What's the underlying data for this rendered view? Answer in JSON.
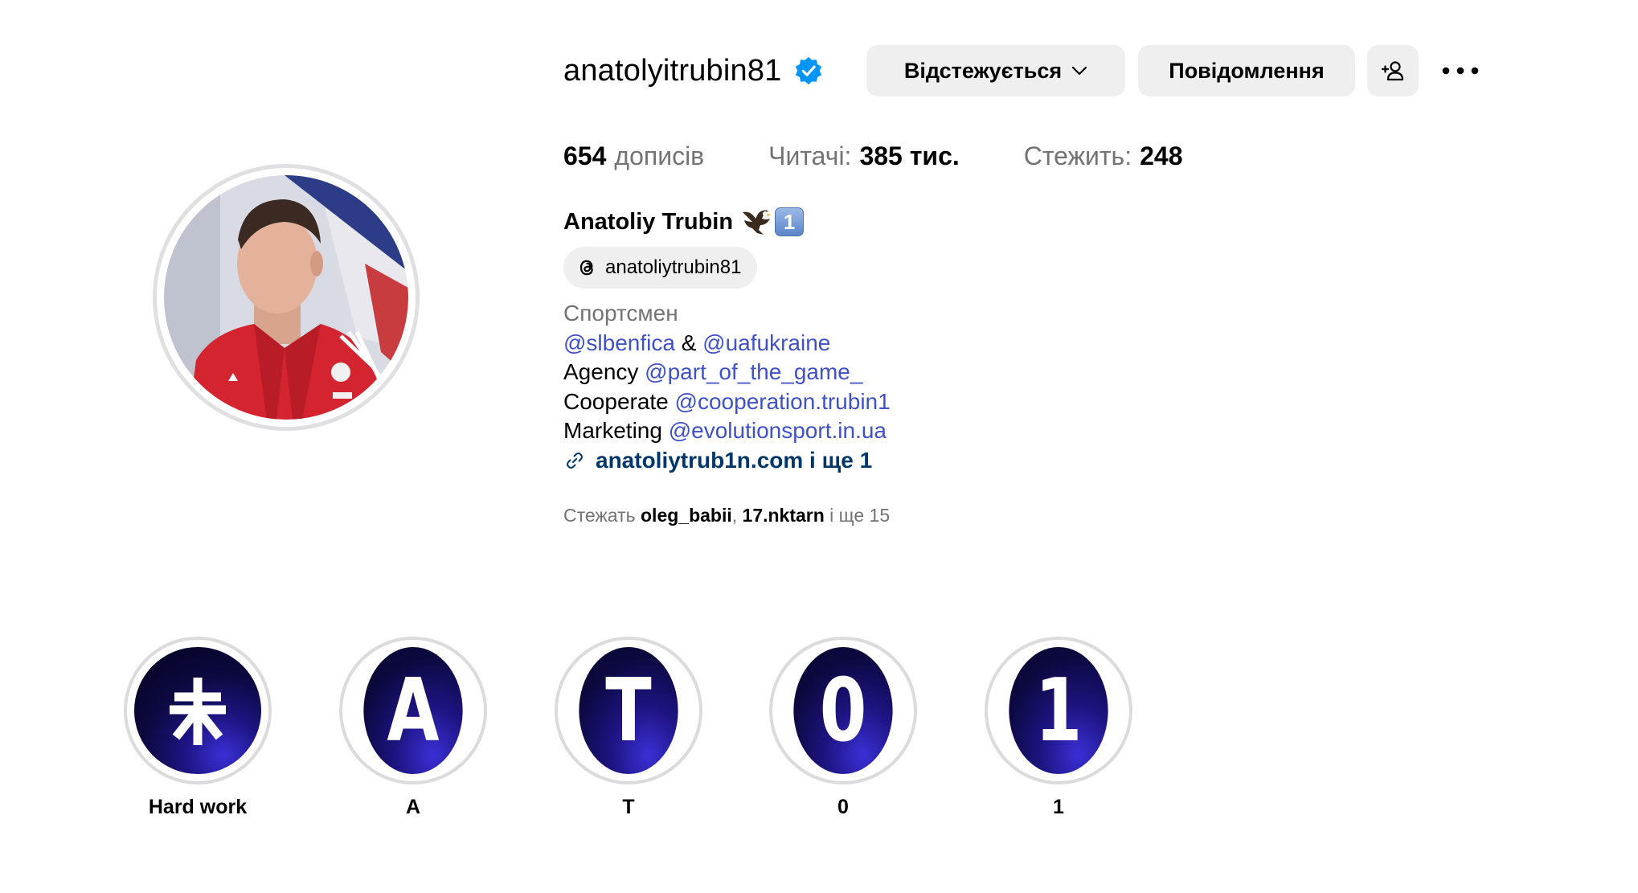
{
  "profile": {
    "username": "anatolyitrubin81",
    "verified_icon": "verified-badge-icon",
    "accent_color": "#0095f6"
  },
  "actions": {
    "follow_label": "Відстежується",
    "message_label": "Повідомлення",
    "add_user_icon": "add-user-icon",
    "more_icon": "more-horizontal-icon"
  },
  "stats": {
    "posts_count": "654",
    "posts_label": "дописів",
    "followers_label": "Читачі:",
    "followers_count": "385 тис.",
    "following_label": "Стежить:",
    "following_count": "248"
  },
  "bio": {
    "full_name": "Anatoliy Trubin",
    "emoji_one": "1",
    "threads_handle": "anatoliytrubin81",
    "category": "Спортсмен",
    "line1_link1": "@slbenfica",
    "line1_amp": " & ",
    "line1_link2": "@uafukraine",
    "line2_prefix": "Agency ",
    "line2_link": "@part_of_the_game_",
    "line3_prefix": "Cooperate ",
    "line3_link": "@cooperation.trubin1",
    "line4_prefix": "Marketing ",
    "line4_link": "@evolutionsport.in.ua",
    "external_link": "anatoliytrub1n.com і ще 1"
  },
  "followed_by": {
    "prefix": "Стежать ",
    "user1": "oleg_babii",
    "sep": ", ",
    "user2": "17.nktarn",
    "suffix": " і ще 15"
  },
  "highlights": [
    {
      "cover": "",
      "label": "Hard work"
    },
    {
      "cover": "A",
      "label": "A"
    },
    {
      "cover": "T",
      "label": "T"
    },
    {
      "cover": "0",
      "label": "0"
    },
    {
      "cover": "1",
      "label": "1"
    }
  ]
}
